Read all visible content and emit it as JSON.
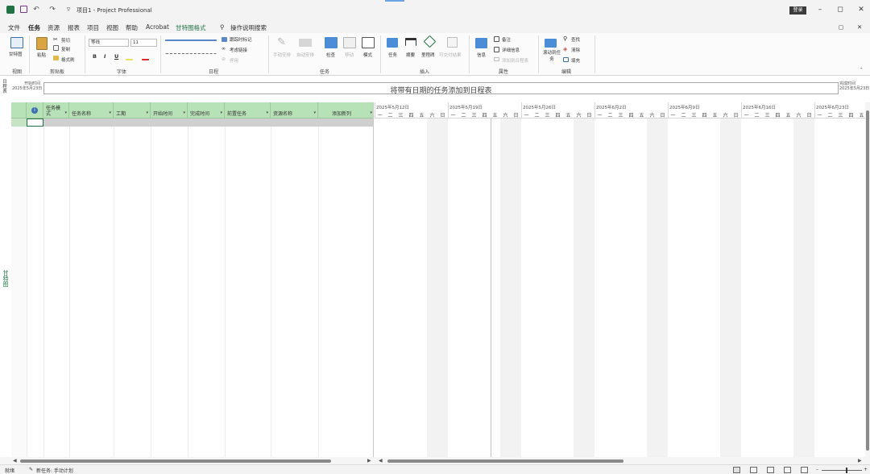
{
  "titlebar": {
    "title": "项目1 - Project Professional",
    "sign_in": "登录",
    "undo": "↶",
    "redo": "↷",
    "customize": "▿",
    "minimize": "–",
    "restore": "◻",
    "close": "✕"
  },
  "ribbon_tabs": [
    "文件",
    "任务",
    "资源",
    "报表",
    "项目",
    "视图",
    "帮助",
    "Acrobat",
    "甘特图格式"
  ],
  "search": {
    "label": "操作说明搜索"
  },
  "ribbon": {
    "view": {
      "button": "甘特图",
      "group": "视图"
    },
    "clipboard": {
      "paste": "粘贴",
      "cut": "剪切",
      "copy": "复制",
      "format_painter": "格式刷",
      "group": "剪贴板"
    },
    "font": {
      "family": "等线",
      "size": "11",
      "bold": "B",
      "italic": "I",
      "underline": "U",
      "group": "字体"
    },
    "schedule": {
      "mark_on_track": "跟踪时标记",
      "respect_links": "考虑链接",
      "inactivate": "停用",
      "group": "日程"
    },
    "tasks": {
      "manual": "手动安排",
      "auto": "自动安排",
      "inspect": "检查",
      "move": "移动",
      "mode": "模式",
      "group": "任务"
    },
    "insert": {
      "task": "任务",
      "summary": "摘要",
      "milestone": "里程碑",
      "deliverable": "可交付结果",
      "group": "插入"
    },
    "properties": {
      "information": "信息",
      "notes": "备注",
      "details": "详细信息",
      "add_to_timeline": "添加到日程表",
      "group": "属性"
    },
    "editing": {
      "scroll_to_task": "滚动到任务",
      "find": "查找",
      "clear": "清除",
      "fill": "填充",
      "group": "编辑"
    }
  },
  "timeline": {
    "side_label": "日程表",
    "start_label": "开始时间",
    "start_date": "2025年5月23日",
    "end_label": "完成时间",
    "end_date": "2025年5月23日",
    "placeholder": "将带有日期的任务添加到日程表"
  },
  "view_label": "甘特图",
  "grid": {
    "columns": [
      "任务模式",
      "任务名称",
      "工期",
      "开始时间",
      "完成时间",
      "前置任务",
      "资源名称",
      "添加新列"
    ]
  },
  "gantt": {
    "weeks": [
      "2025年5月12日",
      "2025年5月19日",
      "2025年5月26日",
      "2025年6月2日",
      "2025年6月9日",
      "2025年6月16日",
      "2025年6月23日"
    ],
    "day_labels": [
      "一",
      "二",
      "三",
      "四",
      "五",
      "六",
      "日"
    ]
  },
  "status": {
    "ready": "就绪",
    "new_tasks": "新任务: 手动计划"
  }
}
